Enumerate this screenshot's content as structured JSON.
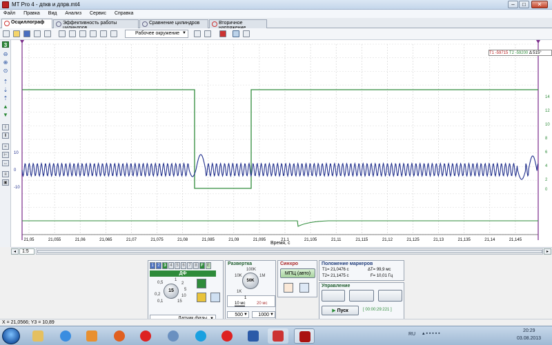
{
  "window": {
    "title": "MT Pro 4 - дпкв и дпрв.mt4"
  },
  "menu": [
    "Файл",
    "Правка",
    "Вид",
    "Анализ",
    "Сервис",
    "Справка"
  ],
  "tabs": [
    {
      "label": "Осциллограф",
      "active": true
    },
    {
      "label": "Эффективность работы цилиндров",
      "active": false
    },
    {
      "label": "Сравнение цилиндров",
      "active": false
    },
    {
      "label": "Вторичное напряжение",
      "active": false
    }
  ],
  "toolbar": {
    "environment_dropdown": "Рабочее окружение"
  },
  "left_toolbar": {
    "channel_indicator": "3"
  },
  "plot": {
    "marker_label_1": "T1 -59715",
    "marker_label_2": "T2 -59200",
    "marker_label_3": "Δ 515°",
    "x_axis_label": "Время, с",
    "x_ticks": [
      "21,05",
      "21,055",
      "21,06",
      "21,065",
      "21,07",
      "21,075",
      "21,08",
      "21,085",
      "21,09",
      "21,095",
      "21,1",
      "21,105",
      "21,11",
      "21,115",
      "21,12",
      "21,125",
      "21,13",
      "21,135",
      "21,14",
      "21,145"
    ],
    "left_ticks": [
      "10",
      "0",
      "-10"
    ],
    "right_ticks": [
      "14",
      "12",
      "10",
      "8",
      "6",
      "4",
      "2",
      "0"
    ]
  },
  "scroll": {
    "zoom": "1:5"
  },
  "channels_panel": {
    "channels": [
      "1",
      "2",
      "3",
      "4",
      "5",
      "6",
      "7",
      "8",
      "F",
      "E"
    ],
    "selected": "3",
    "channel_name": "ДФ",
    "knob_value": "15",
    "knob_ticks": [
      "0,5",
      "1",
      "2",
      "5",
      "10",
      "15",
      "0,2",
      "0,1"
    ],
    "sensor": "Датчик фазы"
  },
  "sweep_panel": {
    "title": "Развертка",
    "knob_value": "50K",
    "knob_ticks": [
      "100K",
      "10K",
      "1M",
      "1K"
    ],
    "marker_one": "1",
    "time1": "10 мс",
    "time2": "20 мс",
    "field1": "500",
    "field2": "1000"
  },
  "sync_panel": {
    "title": "Синхро",
    "mode": "МПЦ (авто)"
  },
  "markers_panel": {
    "title": "Положение маркеров",
    "t1": "T1= 21,0476 с",
    "dt": "ΔT= 99,9 мс",
    "t2": "T2= 21,1475 с",
    "f": "F= 10,01 Гц"
  },
  "control_panel": {
    "title": "Управление",
    "start": "Пуск",
    "timer": "[ 00:00:29:221 ]"
  },
  "status": {
    "coords": "X = 21,0566; Y3 = 10,89"
  },
  "taskbar": {
    "lang": "RU",
    "time": "20:29",
    "date": "03.08.2013"
  },
  "colors": {
    "green_trace": "#2e8b3a",
    "blue_trace": "#1f2e8c",
    "grid": "#c8c8c8"
  }
}
